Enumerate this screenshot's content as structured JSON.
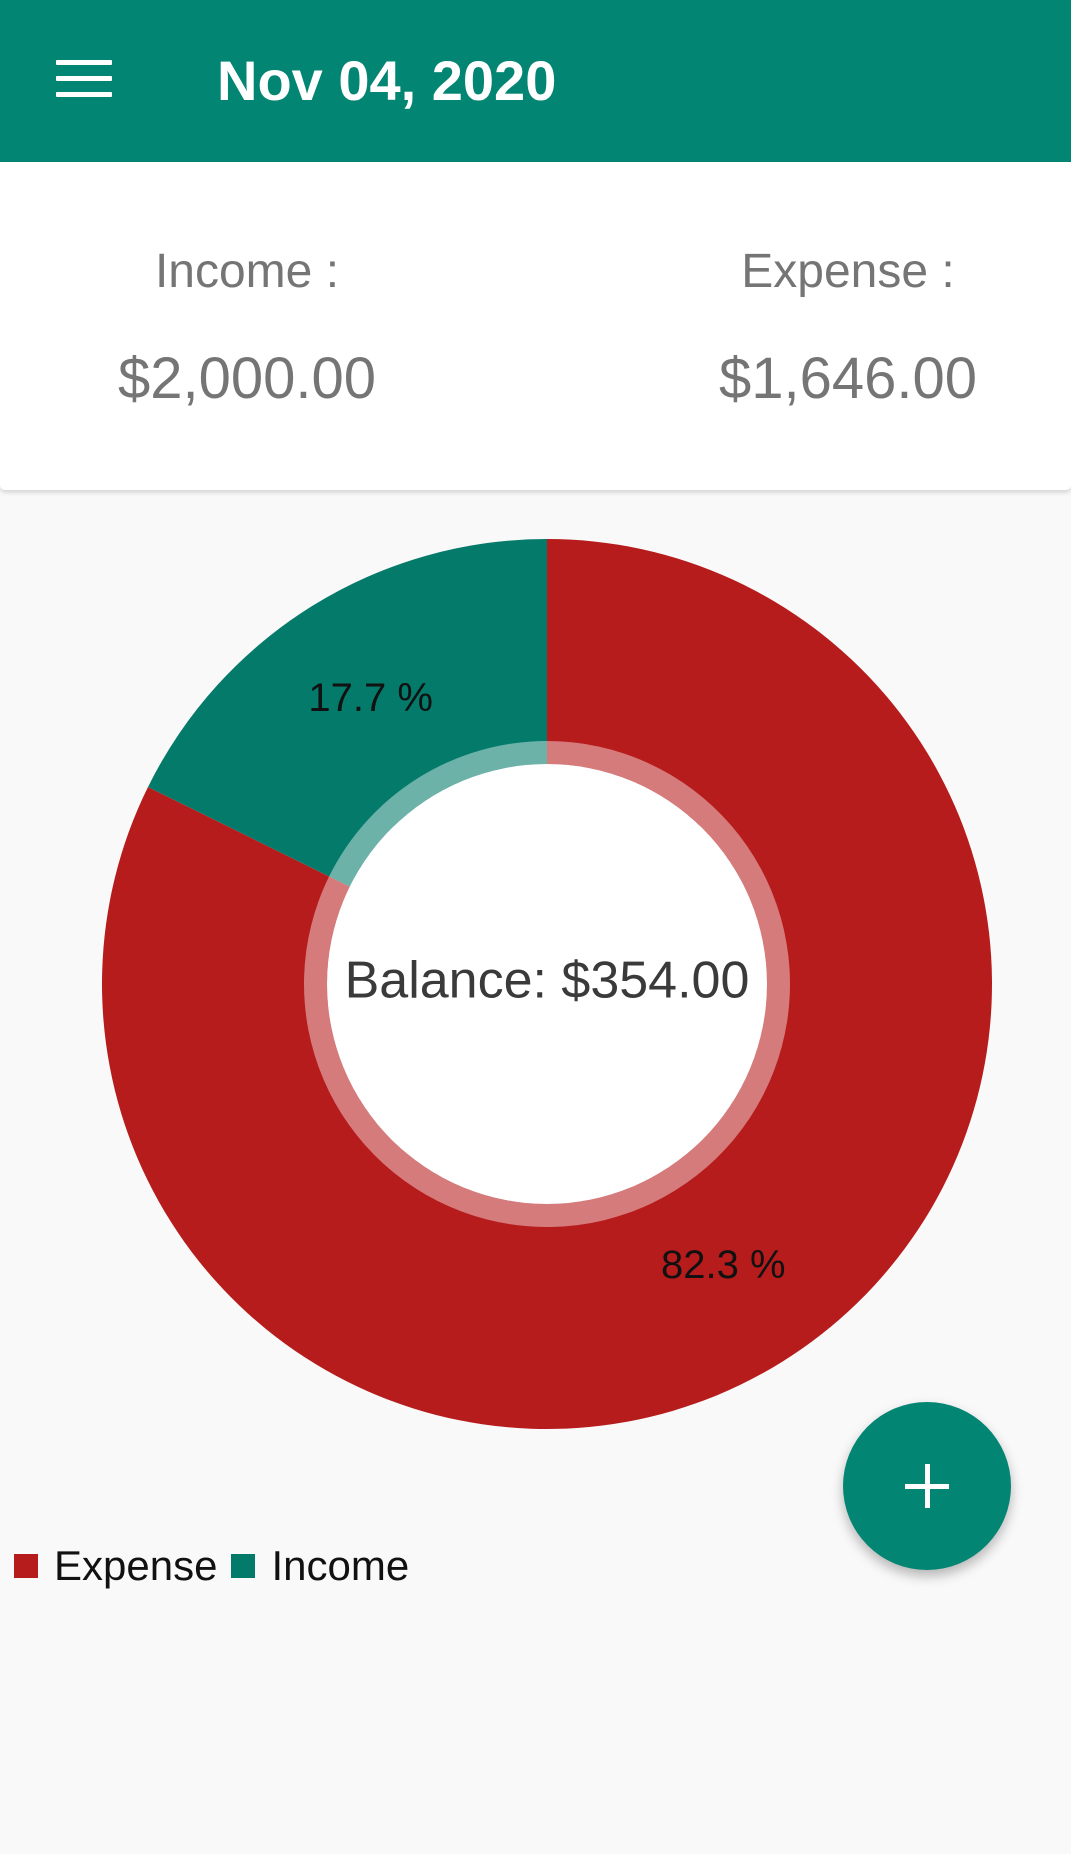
{
  "app_bar": {
    "title": "Nov 04, 2020",
    "menu_icon": "menu-icon",
    "background": "#038573"
  },
  "summary": {
    "income_label": "Income :",
    "income_value": "$2,000.00",
    "expense_label": "Expense :",
    "expense_value": "$1,646.00"
  },
  "chart_data": {
    "type": "pie",
    "center_text": "Balance: $354.00",
    "categories": [
      "Expense",
      "Income"
    ],
    "values": [
      82.3,
      17.7
    ],
    "value_labels": [
      "82.3 %",
      "17.7 %"
    ],
    "colors": [
      "#b71c1c",
      "#047a6b"
    ],
    "legend_position": "bottom-left"
  },
  "legend": {
    "items": [
      {
        "label": "Expense",
        "color": "#b71c1c"
      },
      {
        "label": "Income",
        "color": "#047a6b"
      }
    ]
  },
  "fab": {
    "icon": "plus-icon",
    "background": "#038573"
  }
}
